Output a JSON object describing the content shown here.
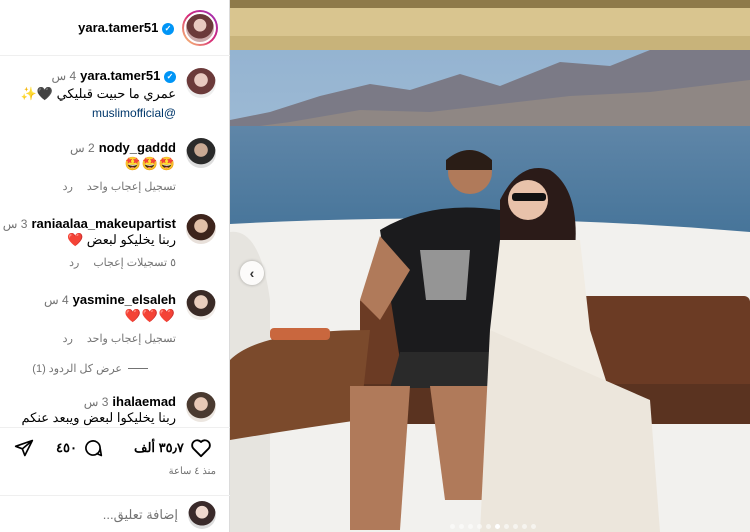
{
  "header": {
    "username": "yara.tamer51"
  },
  "post": {
    "username": "yara.tamer51",
    "time": "4 س",
    "caption": "عمري ما حبيت قبليكي",
    "caption_emoji": "🖤✨",
    "mention": "@muslimofficial"
  },
  "comments": [
    {
      "username": "nody_gaddd",
      "time": "2 س",
      "text": "🤩🤩🤩",
      "like": "تسجيل إعجاب واحد",
      "reply": "رد"
    },
    {
      "username": "raniaalaa_makeupartist",
      "time": "3 س",
      "text": "ربنا يخليكو لبعض",
      "text_emoji": "❤️",
      "like": "٥ تسجيلات إعجاب",
      "reply": "رد"
    },
    {
      "username": "yasmine_elsaleh",
      "time": "4 س",
      "text": "❤️❤️❤️",
      "like": "تسجيل إعجاب واحد",
      "reply": "رد"
    },
    {
      "username": "ihalaemad",
      "time": "3 س",
      "text": "ربنا يخليكوا لبعض ويبعد عنكم"
    }
  ],
  "view_replies": "عرض كل الردود (1)",
  "actions": {
    "likes": "٣٥٫٧ ألف",
    "comments": "٤٥٠"
  },
  "posted_ago": "منذ ٤ ساعة",
  "add_comment_placeholder": "إضافة تعليق...",
  "photo": {
    "slide_count": 10,
    "active_slide": 5
  }
}
